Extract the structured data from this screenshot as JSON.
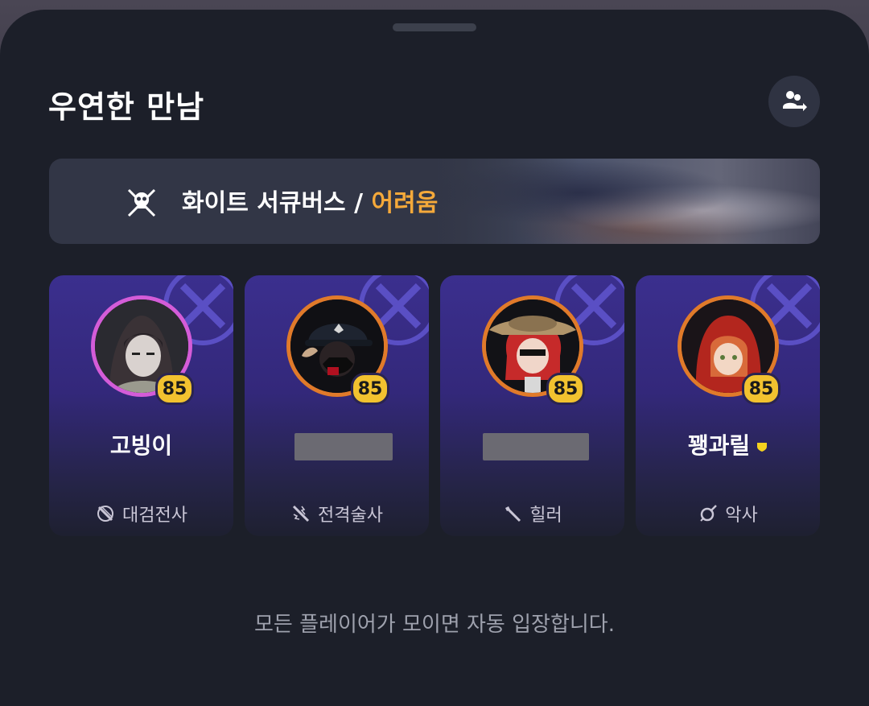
{
  "title": "우연한 만남",
  "share_icon": "party-share-icon",
  "banner": {
    "boss_icon": "skull-crossbones-icon",
    "boss_name": "화이트 서큐버스",
    "separator": " / ",
    "difficulty": "어려움",
    "difficulty_color": "#f5a93a"
  },
  "players": [
    {
      "level": "85",
      "name": "고빙이",
      "name_hidden": false,
      "leader": false,
      "class_icon": "greatsword-icon",
      "class_name": "대검전사",
      "ring_color": "#d45cd8"
    },
    {
      "level": "85",
      "name": "",
      "name_hidden": true,
      "leader": false,
      "class_icon": "battle-mage-icon",
      "class_name": "전격술사",
      "ring_color": "#e07a2a"
    },
    {
      "level": "85",
      "name": "",
      "name_hidden": true,
      "leader": false,
      "class_icon": "healer-staff-icon",
      "class_name": "힐러",
      "ring_color": "#e07a2a"
    },
    {
      "level": "85",
      "name": "꽹과릴",
      "name_hidden": false,
      "leader": true,
      "class_icon": "bard-icon",
      "class_name": "악사",
      "ring_color": "#e07a2a"
    }
  ],
  "footer": "모든 플레이어가 모이면 자동 입장합니다."
}
